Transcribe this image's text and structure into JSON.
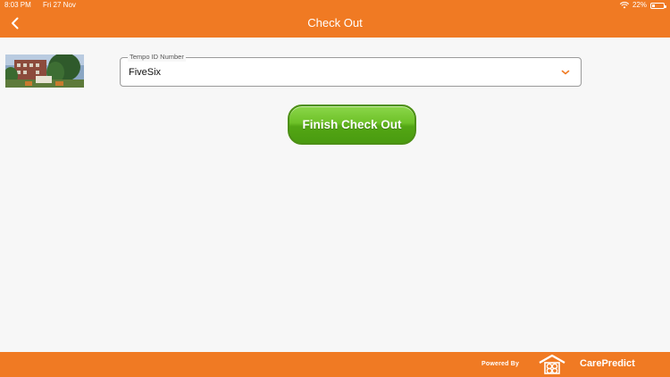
{
  "status": {
    "time": "8:03 PM",
    "date": "Fri 27 Nov",
    "battery": "22%",
    "battery_level": 0.22
  },
  "header": {
    "title": "Check Out",
    "back_icon": "chevron-left-icon"
  },
  "form": {
    "tempo_label": "Tempo ID Number",
    "tempo_value": "FiveSix",
    "dropdown_icon": "chevron-down-icon"
  },
  "actions": {
    "finish_label": "Finish Check Out"
  },
  "footer": {
    "powered_by": "Powered By",
    "brand": "CarePredict"
  },
  "colors": {
    "accent": "#f07a23",
    "button_green": "#5cb31c"
  }
}
